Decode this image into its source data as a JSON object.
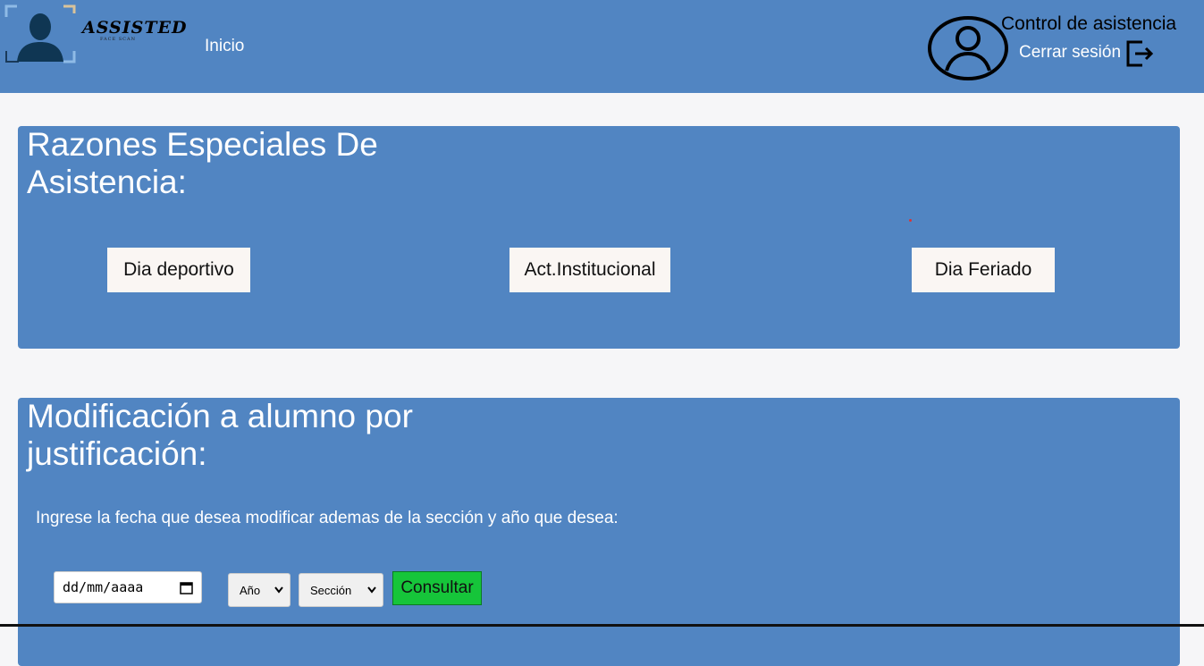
{
  "header": {
    "brand": "ASSISTED",
    "brand_sub": "FACE SCAN",
    "nav_inicio": "Inicio",
    "app_title": "Control de asistencia",
    "logout_label": "Cerrar sesión",
    "colors": {
      "bar": "#5185c2",
      "text": "#ffffff"
    },
    "icons": [
      "person-silhouette-logo-icon",
      "user-avatar-icon",
      "logout-icon"
    ]
  },
  "special_reasons": {
    "title": "Razones Especiales De Asistencia:",
    "buttons": [
      "Dia deportivo",
      "Act.Institucional",
      "Dia Feriado"
    ]
  },
  "modification": {
    "title": "Modificación a alumno por justificación:",
    "instructions": "Ingrese la fecha que desea modificar ademas de la sección y año que desea:",
    "date_placeholder": "dd/mm/aaaa",
    "year_select": "Año",
    "section_select": "Sección",
    "consult_button": "Consultar",
    "colors": {
      "consult_bg": "#16c53a"
    }
  }
}
